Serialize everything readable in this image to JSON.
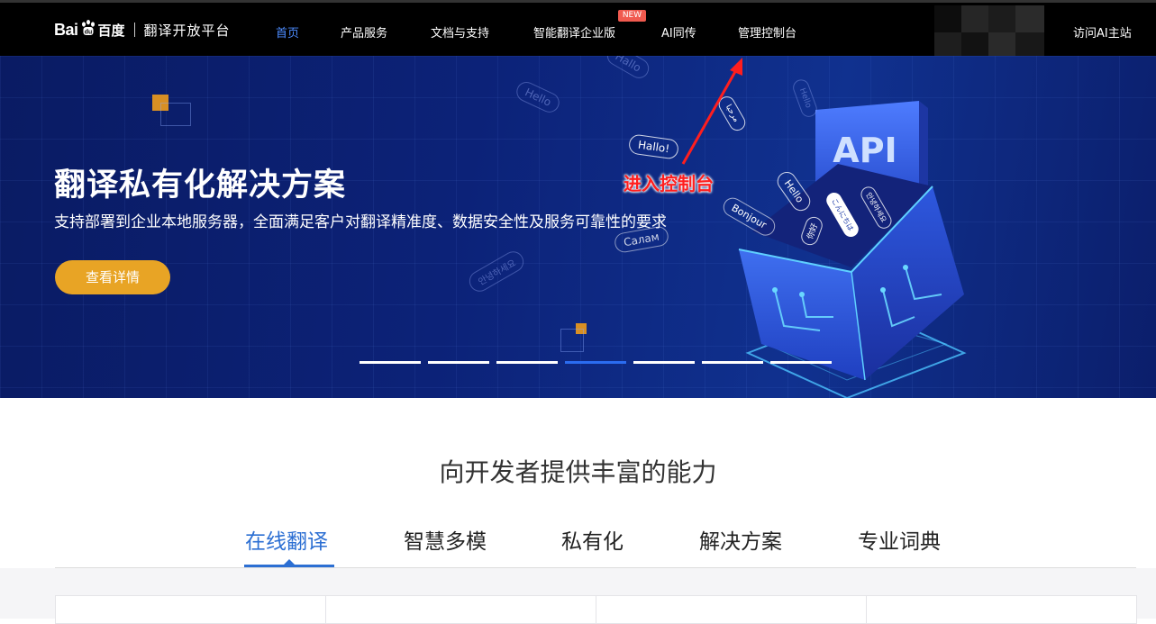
{
  "logo": {
    "bai": "Bai",
    "baidu_cn": "百度",
    "platform": "翻译开放平台"
  },
  "nav": {
    "items": [
      {
        "label": "首页",
        "active": true
      },
      {
        "label": "产品服务"
      },
      {
        "label": "文档与支持"
      },
      {
        "label": "智能翻译企业版",
        "badge": "NEW"
      },
      {
        "label": "AI同传"
      },
      {
        "label": "管理控制台"
      }
    ],
    "right_link": "访问AI主站"
  },
  "hero": {
    "title": "翻译私有化解决方案",
    "subtitle": "支持部署到企业本地服务器，全面满足客户对翻译精准度、数据安全性及服务可靠性的要求",
    "button": "查看详情",
    "carousel_count": 7,
    "carousel_active_index": 3,
    "annotation": "进入控制台",
    "illustration": {
      "cube_label": "API",
      "chips": [
        "Hallo!",
        "Hello",
        "Bonjour",
        "Салам",
        "你好",
        "こんにちは",
        "안녕하세요",
        "Hello",
        "Hallo",
        "Hello",
        "مرحبا",
        "안녕하세요"
      ]
    }
  },
  "section": {
    "title": "向开发者提供丰富的能力",
    "tabs": [
      "在线翻译",
      "智慧多模",
      "私有化",
      "解决方案",
      "专业词典"
    ],
    "active_tab": 0
  },
  "colors": {
    "accent_blue": "#2c6fd3",
    "nav_active": "#4d8cff",
    "button_orange": "#e8a425",
    "annotation_red": "#ff1e1e",
    "badge_red": "#f05a4f"
  }
}
